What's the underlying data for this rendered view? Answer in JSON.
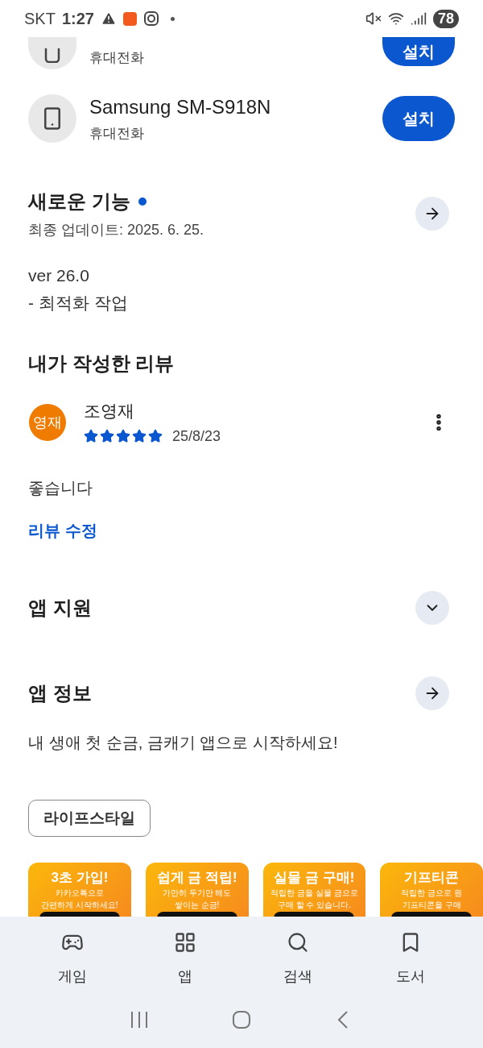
{
  "status_bar": {
    "carrier": "SKT",
    "time": "1:27",
    "battery": "78"
  },
  "devices": [
    {
      "type": "휴대전화",
      "button": "설치"
    },
    {
      "name": "Samsung SM-S918N",
      "type": "휴대전화",
      "button": "설치"
    }
  ],
  "whats_new": {
    "title": "새로운 기능",
    "new_dot": true,
    "updated": "최종 업데이트: 2025. 6. 25.",
    "notes": [
      "ver 26.0",
      "- 최적화 작업"
    ]
  },
  "my_review": {
    "title": "내가 작성한 리뷰",
    "author": "조영재",
    "avatar": "영재",
    "stars": 5,
    "date": "25/8/23",
    "text": "좋습니다",
    "edit_link": "리뷰 수정"
  },
  "app_support": {
    "title": "앱 지원",
    "expanded": false
  },
  "app_info": {
    "title": "앱 정보",
    "description": "내 생애 첫 순금, 금캐기 앱으로 시작하세요!",
    "category": "라이프스타일"
  },
  "screenshots": [
    {
      "title": "3초 가입!",
      "lines": [
        "카카오톡으로",
        "간편하게 시작하세요!"
      ]
    },
    {
      "title": "쉽게 금 적립!",
      "lines": [
        "가만히 두기만 해도",
        "쌓이는 순금!"
      ]
    },
    {
      "title": "실물 금 구매!",
      "lines": [
        "적립한 금을 실물 금으로",
        "구매 할 수 있습니다."
      ]
    },
    {
      "title": "기프티콘",
      "lines": [
        "적립한 금으로 원",
        "기프티콘을 구매"
      ]
    }
  ],
  "bottom_nav": [
    {
      "kind": "games",
      "label": "게임",
      "selected": false
    },
    {
      "kind": "apps",
      "label": "앱",
      "selected": false
    },
    {
      "kind": "search",
      "label": "검색",
      "selected": false
    },
    {
      "kind": "books",
      "label": "도서",
      "selected": false
    }
  ]
}
